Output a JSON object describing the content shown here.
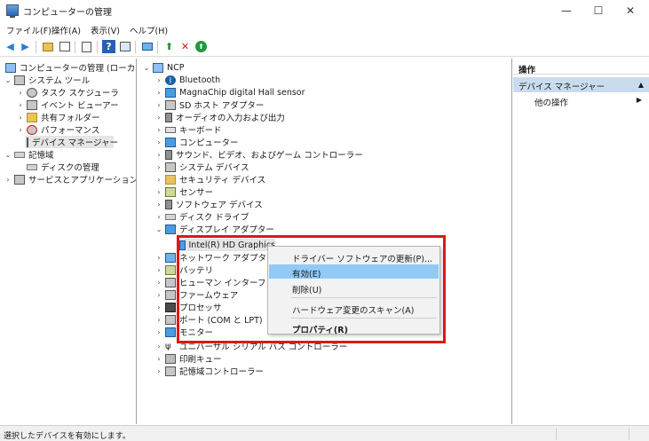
{
  "window": {
    "title": "コンピューターの管理"
  },
  "title_controls": {
    "minimize": "—",
    "maximize": "☐",
    "close": "✕"
  },
  "menubar": [
    "ファイル(F)",
    "操作(A)",
    "表示(V)",
    "ヘルプ(H)"
  ],
  "left_tree": {
    "root": "コンピューターの管理 (ローカル)",
    "system_tools": "システム ツール",
    "task_scheduler": "タスク スケジューラ",
    "event_viewer": "イベント ビューアー",
    "shared_folders": "共有フォルダー",
    "performance": "パフォーマンス",
    "device_manager": "デバイス マネージャー",
    "storage": "記憶域",
    "disk_management": "ディスクの管理",
    "services_apps": "サービスとアプリケーション"
  },
  "device_tree": {
    "root": "NCP",
    "items": [
      "Bluetooth",
      "MagnaChip digital Hall sensor",
      "SD ホスト アダプター",
      "オーディオの入力および出力",
      "キーボード",
      "コンピューター",
      "サウンド、ビデオ、およびゲーム コントローラー",
      "システム デバイス",
      "セキュリティ デバイス",
      "センサー",
      "ソフトウェア デバイス",
      "ディスク ドライブ",
      "ディスプレイ アダプター"
    ],
    "display_child": "Intel(R) HD Graphics",
    "after_items": [
      "ネットワーク アダプター",
      "バッテリ",
      "ヒューマン インターフェイス デ",
      "ファームウェア",
      "プロセッサ",
      "ポート (COM と LPT)",
      "モニター",
      "ユニバーサル シリアル バス コントローラー",
      "印刷キュー",
      "記憶域コントローラー"
    ]
  },
  "context_menu": {
    "update_driver": "ドライバー ソフトウェアの更新(P)...",
    "enable": "有効(E)",
    "uninstall": "削除(U)",
    "scan": "ハードウェア変更のスキャン(A)",
    "properties": "プロパティ(R)"
  },
  "actions_pane": {
    "header": "操作",
    "section": "デバイス マネージャー",
    "other": "他の操作"
  },
  "status": {
    "text": "選択したデバイスを有効にします。"
  },
  "colors": {
    "highlight": "#91c9f7",
    "annotation_border": "#e01616",
    "action_header": "#c9dcef"
  }
}
